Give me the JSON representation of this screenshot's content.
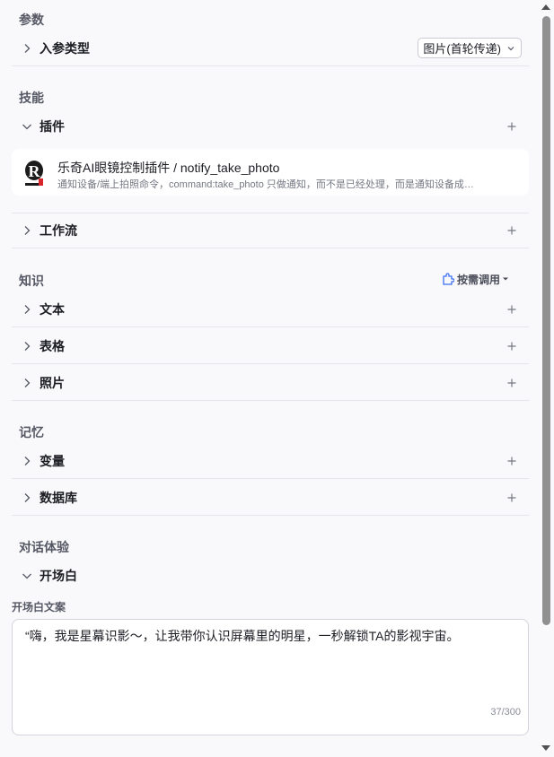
{
  "sections": {
    "params": "参数",
    "skills": "技能",
    "knowledge": "知识",
    "memory": "记忆",
    "dialog": "对话体验"
  },
  "params": {
    "input_type_label": "入参类型",
    "input_type_value": "图片(首轮传递)"
  },
  "skills": {
    "plugin_label": "插件",
    "plugin": {
      "title": "乐奇AI眼镜控制插件 / notify_take_photo",
      "desc": "通知设备/端上拍照命令，command:take_photo 只做通知，而不是已经处理，而是通知设备成…"
    },
    "workflow_label": "工作流"
  },
  "knowledge": {
    "mode": "按需调用",
    "items": [
      "文本",
      "表格",
      "照片"
    ]
  },
  "memory": {
    "items": [
      "变量",
      "数据库"
    ]
  },
  "dialog": {
    "opener_label": "开场白",
    "opener_text_label": "开场白文案",
    "opener_text": "“嗨，我是星幕识影～，让我带你认识屏幕里的明星，一秒解锁TA的影视宇宙。",
    "counter": "37/300"
  },
  "icons": {
    "expand": "chevron-right-icon",
    "collapse": "chevron-down-icon",
    "add": "plus-icon",
    "plugin_logo": "plugin-logo-icon",
    "mode": "puzzle-icon"
  },
  "colors": {
    "background": "#f9f9fb",
    "text": "#1c1d23",
    "muted": "#555864",
    "divider": "#e5e6eb",
    "scrollbar": "#909090"
  }
}
